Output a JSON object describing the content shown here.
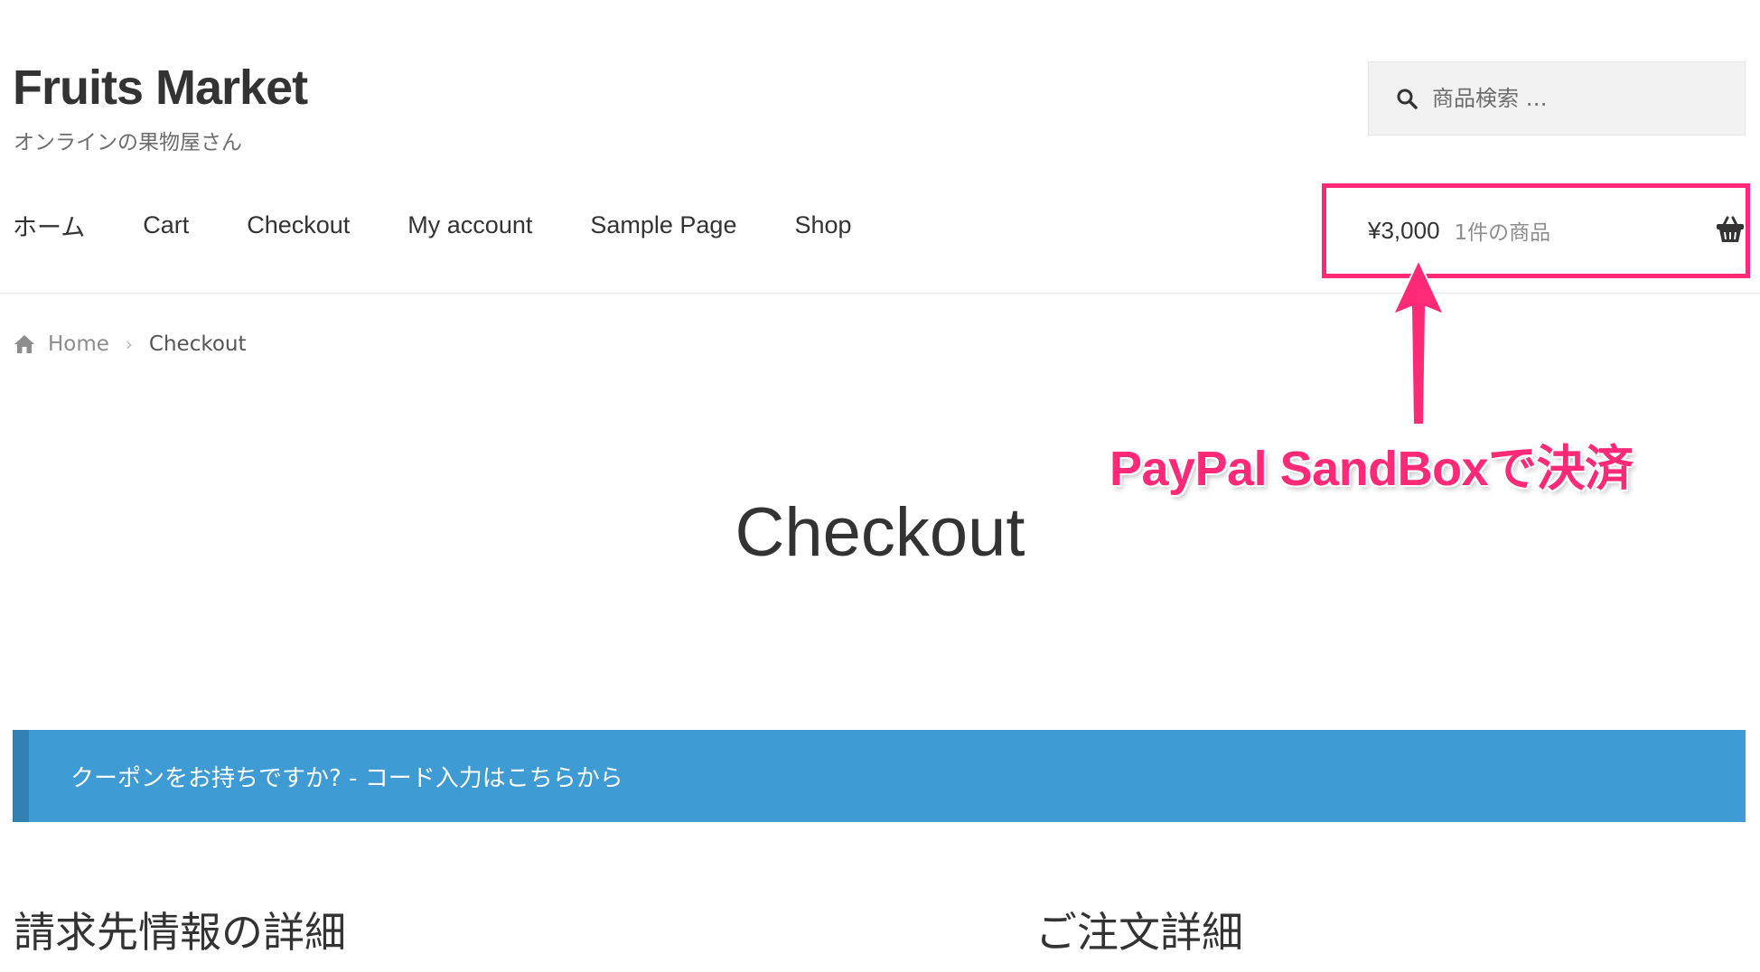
{
  "header": {
    "site_title": "Fruits Market",
    "tagline": "オンラインの果物屋さん",
    "search": {
      "placeholder": "商品検索 …",
      "icon": "search-icon"
    }
  },
  "nav": {
    "items": [
      {
        "label": "ホーム"
      },
      {
        "label": "Cart"
      },
      {
        "label": "Checkout"
      },
      {
        "label": "My account"
      },
      {
        "label": "Sample Page"
      },
      {
        "label": "Shop"
      }
    ]
  },
  "cart": {
    "amount": "¥3,000",
    "count_label": "1件の商品",
    "icon": "basket-icon"
  },
  "breadcrumb": {
    "home_icon": "home-icon",
    "home": "Home",
    "current": "Checkout"
  },
  "annotation": {
    "text": "PayPal SandBoxで決済",
    "color": "#ff2a77"
  },
  "page": {
    "title": "Checkout"
  },
  "coupon_notice": {
    "text": "クーポンをお持ちですか? - コード入力はこちらから",
    "color": "#3e9bd4"
  },
  "sections": {
    "billing_heading": "請求先情報の詳細",
    "order_heading": "ご注文詳細"
  }
}
